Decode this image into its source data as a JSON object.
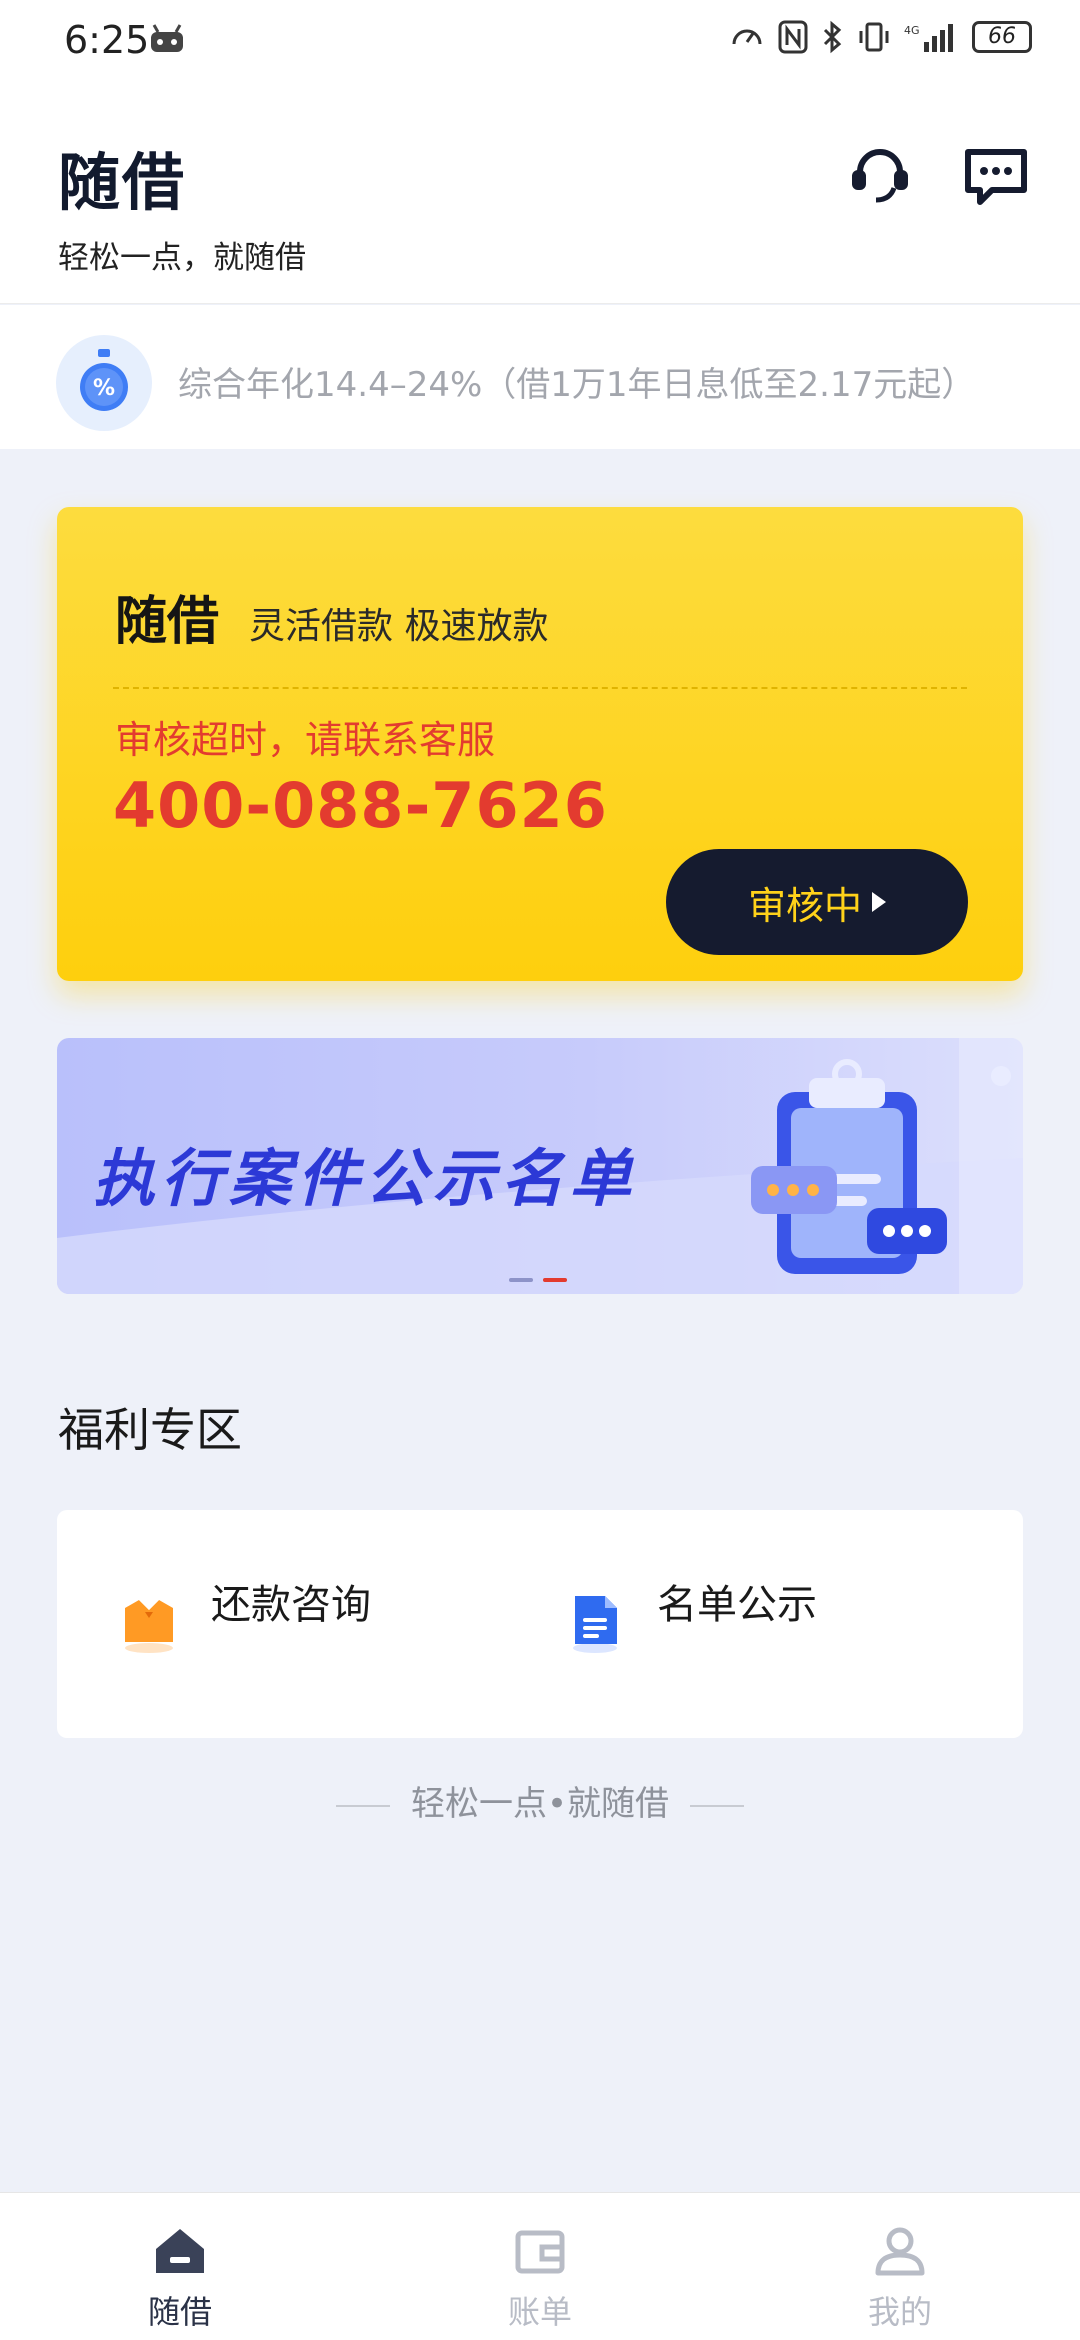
{
  "status_bar": {
    "time": "6:25",
    "battery": "66"
  },
  "header": {
    "title": "随借",
    "subtitle": "轻松一点，就随借"
  },
  "rate_info": {
    "text": "综合年化14.4–24%（借1万1年日息低至2.17元起）"
  },
  "loan_card": {
    "name": "随借",
    "tagline": "灵活借款 极速放款",
    "warning": "审核超时，请联系客服",
    "phone": "400-088-7626",
    "status_button": "审核中"
  },
  "banner": {
    "text": "执行案件公示名单"
  },
  "welfare": {
    "title": "福利专区",
    "items": [
      {
        "label": "还款咨询",
        "icon": "shirt-icon"
      },
      {
        "label": "名单公示",
        "icon": "document-icon"
      }
    ]
  },
  "slogan": "轻松一点•就随借",
  "bottom_nav": {
    "items": [
      {
        "label": "随借",
        "icon": "home-icon",
        "active": true
      },
      {
        "label": "账单",
        "icon": "wallet-icon",
        "active": false
      },
      {
        "label": "我的",
        "icon": "user-icon",
        "active": false
      }
    ]
  },
  "colors": {
    "card_yellow": "#fecf0d",
    "warning_red": "#e33b2f",
    "dark_navy": "#151b2f",
    "banner_blue": "#2c39d6"
  }
}
